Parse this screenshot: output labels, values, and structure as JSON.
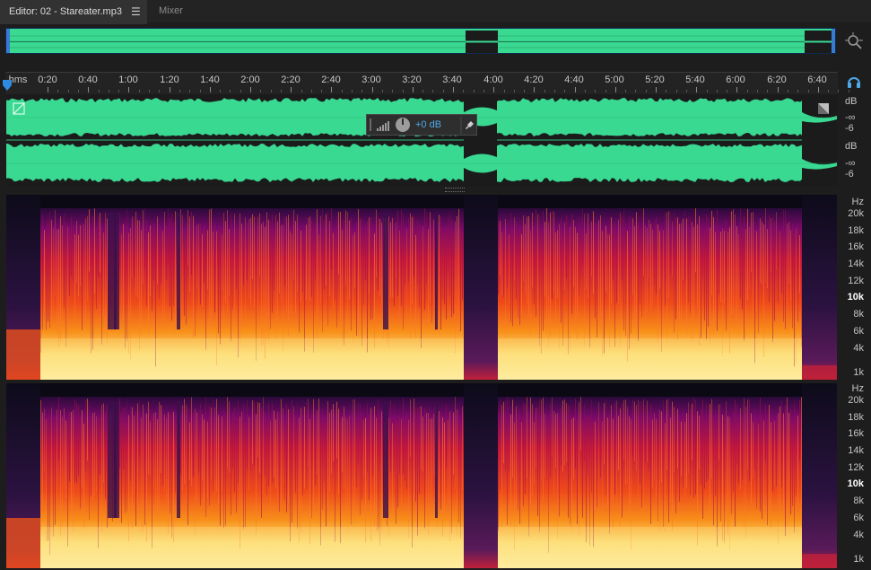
{
  "tabs": {
    "editor_label": "Editor: 02 - Stareater.mp3",
    "menu_glyph": "☰",
    "mixer_label": "Mixer"
  },
  "ruler": {
    "unit_label": "hms",
    "ticks": [
      "0:20",
      "0:40",
      "1:00",
      "1:20",
      "1:40",
      "2:00",
      "2:20",
      "2:40",
      "3:00",
      "3:20",
      "3:40",
      "4:00",
      "4:20",
      "4:40",
      "5:00",
      "5:20",
      "5:40",
      "6:00",
      "6:20",
      "6:40"
    ]
  },
  "db_scale": {
    "top": {
      "unit": "dB",
      "neg_inf": "-∞",
      "minus6": "-6"
    },
    "bottom": {
      "unit": "dB",
      "neg_inf": "-∞",
      "minus6": "-6"
    }
  },
  "hud": {
    "volume_value": "+0 dB"
  },
  "hz_scale": {
    "unit": "Hz",
    "labels": [
      "20k",
      "18k",
      "16k",
      "14k",
      "12k",
      "10k",
      "8k",
      "6k",
      "4k",
      "1k"
    ],
    "bold_label": "10k"
  },
  "colors": {
    "waveform": "#39d992",
    "accent": "#3a8fd8",
    "background": "#1d1d1d"
  },
  "icons": {
    "zoom": "zoom-icon",
    "headphones": "headphones-icon",
    "meter": "meter-icon",
    "knob": "volume-knob-icon",
    "pin": "pin-icon"
  }
}
